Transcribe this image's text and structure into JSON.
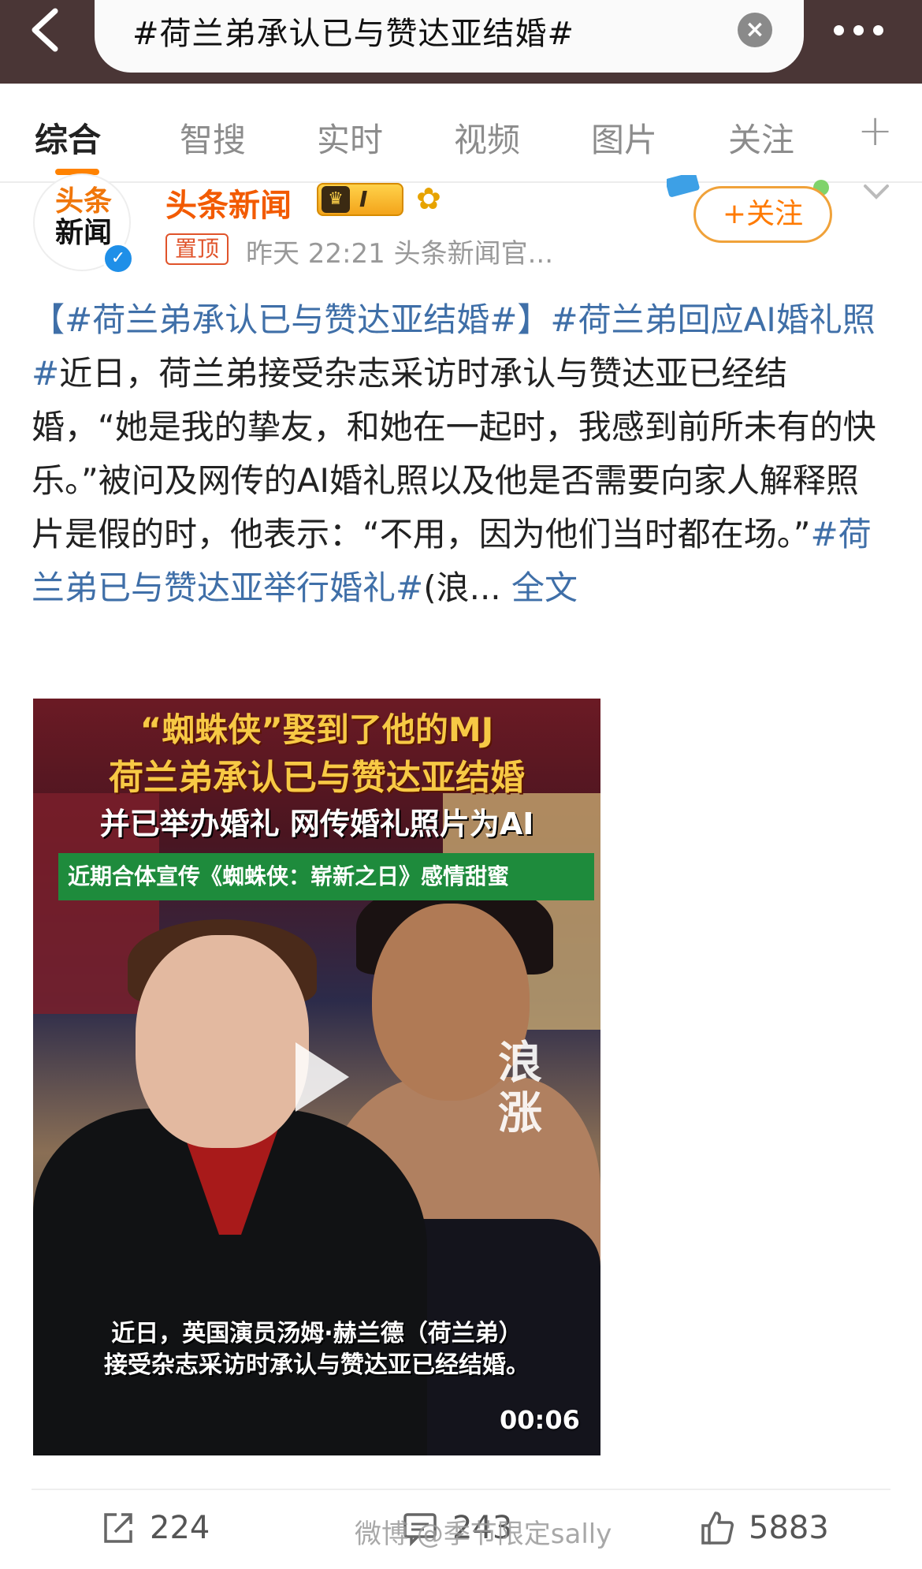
{
  "header": {
    "search_text": "#荷兰弟承认已与赞达亚结婚#",
    "back_icon": "chevron-left-icon",
    "clear_icon": "close-circle-icon",
    "more_icon": "more-dots-icon",
    "clear_glyph": "×"
  },
  "tabs": [
    {
      "label": "综合",
      "active": true
    },
    {
      "label": "智搜",
      "active": false
    },
    {
      "label": "实时",
      "active": false
    },
    {
      "label": "视频",
      "active": false
    },
    {
      "label": "图片",
      "active": false
    },
    {
      "label": "关注",
      "active": false
    }
  ],
  "tabs_plus": "+",
  "post": {
    "author": "头条新闻",
    "avatar_logo_line1": "头条",
    "avatar_logo_line2": "新闻",
    "level_badge": "I",
    "pinned_label": "置顶",
    "meta": "昨天 22:21  头条新闻官...",
    "follow_label": "+关注",
    "text_segments": [
      {
        "type": "tag",
        "text": "【#荷兰弟承认已与赞达亚结婚#】"
      },
      {
        "type": "tag",
        "text": "#荷兰弟回应AI婚礼照#"
      },
      {
        "type": "text",
        "text": "近日，荷兰弟接受杂志采访时承认与赞达亚已经结婚，“她是我的挚友，和她在一起时，我感到前所未有的快乐。”被问及网传的AI婚礼照以及他是否需要向家人解释照片是假的时，他表示：“不用，因为他们当时都在场。”"
      },
      {
        "type": "tag",
        "text": "#荷兰弟已与赞达亚举行婚礼#"
      },
      {
        "type": "text",
        "text": "(浪..."
      },
      {
        "type": "link",
        "text": " 全文"
      }
    ]
  },
  "video": {
    "title_line1": "“蜘蛛侠”娶到了他的MJ",
    "title_line2": "荷兰弟承认已与赞达亚结婚",
    "title_line3": "并已举办婚礼 网传婚礼照片为AI",
    "banner": "近期合体宣传《蜘蛛侠：崭新之日》感情甜蜜",
    "watermark": "浪涨",
    "subtitle_line1": "近日，英国演员汤姆·赫兰德（荷兰弟）",
    "subtitle_line2": "接受杂志采访时承认与赞达亚已经结婚。",
    "duration": "00:06"
  },
  "actions": {
    "repost_count": "224",
    "comment_count": "243",
    "like_count": "5883"
  },
  "watermark": "微博 @季节限定sally",
  "colors": {
    "accent_orange": "#ff8200",
    "author_orange": "#f25a00",
    "tag_blue": "#3f6fa8",
    "header_bg": "#4a3636"
  }
}
